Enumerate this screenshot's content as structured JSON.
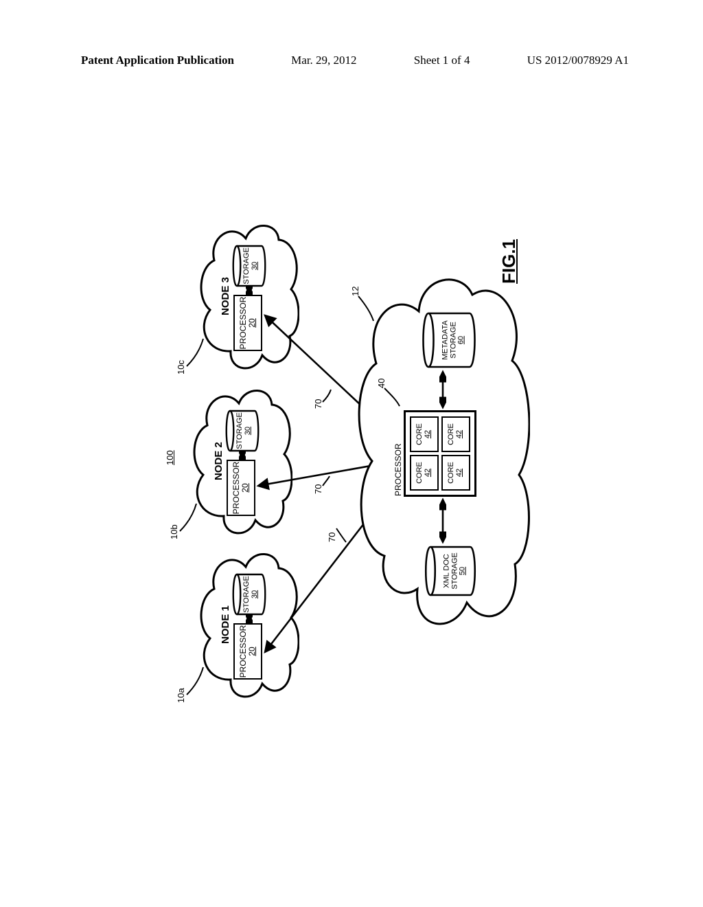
{
  "header": {
    "left": "Patent Application Publication",
    "date": "Mar. 29, 2012",
    "sheet": "Sheet 1 of 4",
    "pub_no": "US 2012/0078929 A1"
  },
  "figure": {
    "label": "FIG.1",
    "overall_ref": "100",
    "nodes": [
      {
        "id": "a",
        "label": "NODE 1",
        "lead_ref": "10a",
        "processor": {
          "title": "PROCESSOR",
          "ref": "20"
        },
        "storage": {
          "title": "STORAGE",
          "ref": "30"
        }
      },
      {
        "id": "b",
        "label": "NODE 2",
        "lead_ref": "10b",
        "processor": {
          "title": "PROCESSOR",
          "ref": "20"
        },
        "storage": {
          "title": "STORAGE",
          "ref": "30"
        }
      },
      {
        "id": "c",
        "label": "NODE 3",
        "lead_ref": "10c",
        "processor": {
          "title": "PROCESSOR",
          "ref": "20"
        },
        "storage": {
          "title": "STORAGE",
          "ref": "30"
        }
      }
    ],
    "central": {
      "lead_ref": "12",
      "processor_lead_ref": "40",
      "processor_title": "PROCESSOR",
      "core_title": "CORE",
      "core_ref": "42",
      "xml_storage": {
        "title_line1": "XML DOC",
        "title_line2": "STORAGE",
        "ref": "50"
      },
      "metadata_storage": {
        "title_line1": "METADATA",
        "title_line2": "STORAGE",
        "ref": "60"
      }
    },
    "conn_ref": "70"
  }
}
